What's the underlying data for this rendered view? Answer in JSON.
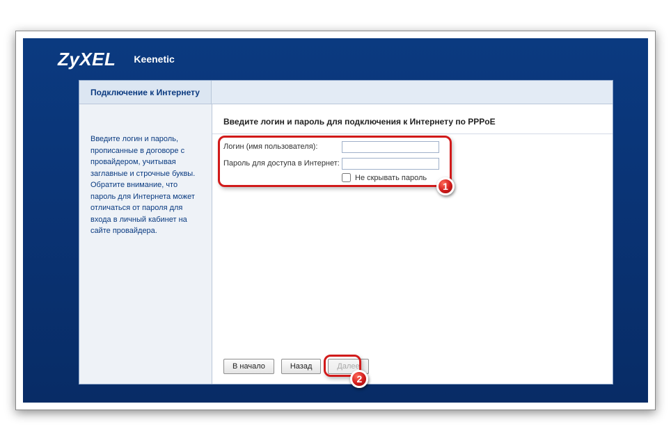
{
  "brand": "ZyXEL",
  "product": "Keenetic",
  "tab_title": "Подключение к Интернету",
  "side_text": "Введите логин и пароль, прописанные в договоре с провайдером, учитывая заглавные и строчные буквы. Обратите внимание, что пароль для Интернета может отличаться от пароля для входа в личный кабинет на сайте провайдера.",
  "main_heading": "Введите логин и пароль для подключения к Интернету по PPPoE",
  "form": {
    "login_label": "Логин (имя пользователя):",
    "login_value": "",
    "password_label": "Пароль для доступа в Интернет:",
    "password_value": "",
    "show_pw_label": "Не скрывать пароль"
  },
  "buttons": {
    "restart": "В начало",
    "back": "Назад",
    "next": "Далее"
  },
  "annotations": {
    "badge1": "1",
    "badge2": "2"
  }
}
